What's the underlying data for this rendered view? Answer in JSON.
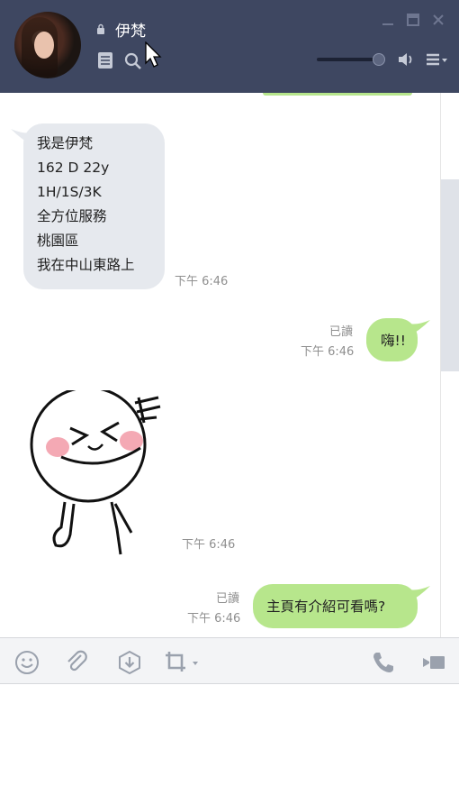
{
  "header": {
    "title": "伊梵",
    "lock_icon": "lock-icon",
    "notes_icon": "notes-icon",
    "search_icon": "search-icon",
    "speaker_icon": "speaker-icon",
    "menu_icon": "menu-icon",
    "volume_level": 0.88,
    "window_controls": [
      "minimize-icon",
      "maximize-icon",
      "close-icon"
    ],
    "colors": {
      "background": "#3e4761",
      "text": "#ffffff"
    }
  },
  "messages": [
    {
      "direction": "incoming",
      "lines": [
        "我是伊梵",
        "162 D 22y",
        "1H/1S/3K",
        "全方位服務",
        "桃園區",
        "我在中山東路上"
      ],
      "time": "下午 6:46"
    },
    {
      "direction": "outgoing",
      "text": "嗨!!",
      "read": "已讀",
      "time": "下午 6:46"
    },
    {
      "direction": "incoming",
      "type": "sticker",
      "sticker": "laughing-face-sticker",
      "time": "下午 6:46"
    },
    {
      "direction": "outgoing",
      "text": "主頁有介紹可看嗎?",
      "read": "已讀",
      "time": "下午 6:46"
    }
  ],
  "colors": {
    "incoming_bubble": "#e6e9ee",
    "outgoing_bubble": "#b7e68c",
    "timestamp": "#8f8f8f"
  },
  "toolbar": {
    "left_icons": [
      "emoji-icon",
      "attach-icon",
      "keep-icon",
      "crop-icon"
    ],
    "right_icons": [
      "phone-icon",
      "video-icon"
    ]
  }
}
